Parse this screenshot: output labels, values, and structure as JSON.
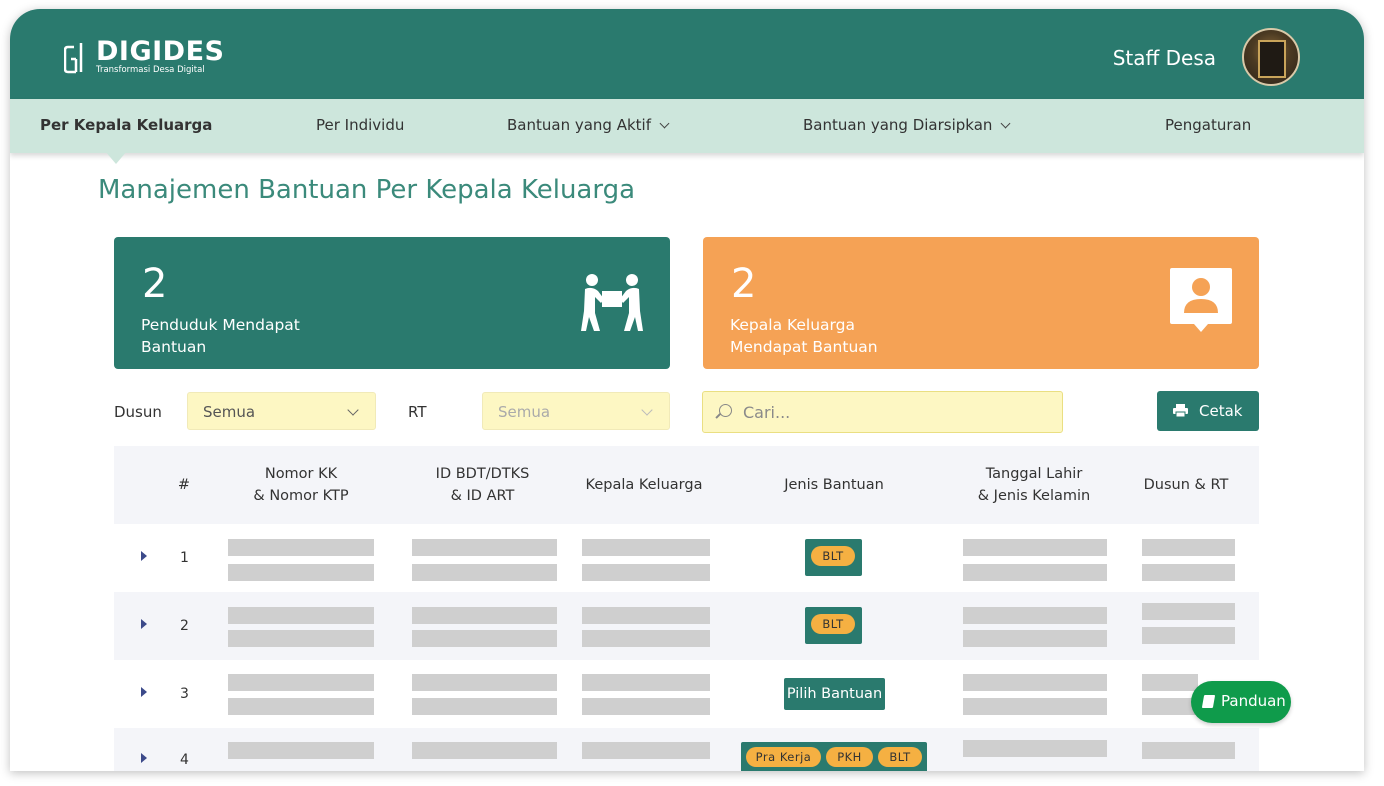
{
  "app": {
    "logo_title": "DIGIDES",
    "logo_subtitle": "Transformasi Desa Digital",
    "user_name": "Staff Desa"
  },
  "nav": {
    "items": [
      {
        "label": "Per Kepala Keluarga",
        "active": true
      },
      {
        "label": "Per Individu"
      },
      {
        "label": "Bantuan yang Aktif",
        "dropdown": true
      },
      {
        "label": "Bantuan yang Diarsipkan",
        "dropdown": true
      },
      {
        "label": "Pengaturan"
      }
    ]
  },
  "page": {
    "title": "Manajemen Bantuan Per Kepala Keluarga"
  },
  "stats": [
    {
      "value": "2",
      "label": "Penduduk Mendapat Bantuan",
      "color": "#2a7a6e",
      "icon": "people-carrying-box-icon"
    },
    {
      "value": "2",
      "label": "Kepala Keluarga Mendapat Bantuan",
      "color": "#f5a255",
      "icon": "user-profile-card-icon"
    }
  ],
  "filters": {
    "dusun_label": "Dusun",
    "dusun_value": "Semua",
    "rt_label": "RT",
    "rt_value": "Semua",
    "search_placeholder": "Cari...",
    "print_label": "Cetak"
  },
  "table": {
    "headers": {
      "index": "#",
      "kk_line1": "Nomor KK",
      "kk_line2": "& Nomor KTP",
      "bdt_line1": "ID BDT/DTKS",
      "bdt_line2": "& ID ART",
      "kepala": "Kepala Keluarga",
      "jenis": "Jenis Bantuan",
      "tgl_line1": "Tanggal Lahir",
      "tgl_line2": "& Jenis Kelamin",
      "dusun_rt": "Dusun & RT"
    },
    "rows": [
      {
        "no": "1",
        "bantuan": [
          "BLT"
        ]
      },
      {
        "no": "2",
        "bantuan": [
          "BLT"
        ]
      },
      {
        "no": "3",
        "bantuan": [],
        "pilih_label": "Pilih Bantuan"
      },
      {
        "no": "4",
        "bantuan": [
          "Pra Kerja",
          "PKH",
          "BLT"
        ]
      }
    ]
  },
  "panduan_label": "Panduan",
  "colors": {
    "primary": "#2a7a6e",
    "nav_bg": "#cde6dc",
    "accent_orange": "#f5a255",
    "pill": "#f5b042",
    "panduan": "#0f9b4b"
  }
}
